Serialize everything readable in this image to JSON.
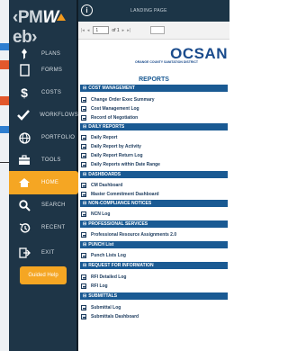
{
  "sidebar": {
    "logo": {
      "left": "‹PM",
      "right": "eb›"
    },
    "items": [
      {
        "label": "PLANS",
        "icon": "pin-icon"
      },
      {
        "label": "FORMS",
        "icon": "document-icon"
      },
      {
        "label": "COSTS",
        "icon": "dollar-icon"
      },
      {
        "label": "WORKFLOWS",
        "icon": "check-icon"
      },
      {
        "label": "PORTFOLIO",
        "icon": "globe-icon"
      },
      {
        "label": "TOOLS",
        "icon": "toolbox-icon"
      },
      {
        "label": "HOME",
        "icon": "home-icon"
      },
      {
        "label": "SEARCH",
        "icon": "search-icon"
      },
      {
        "label": "RECENT",
        "icon": "history-icon"
      },
      {
        "label": "EXIT",
        "icon": "exit-icon"
      }
    ],
    "guided_help": "Guided Help"
  },
  "topbar": {
    "title": "LANDING PAGE"
  },
  "pager": {
    "page": "1",
    "of": "of 1"
  },
  "report": {
    "brand": {
      "name": "OCSAN",
      "sub": "ORANGE COUNTY SANITATION DISTRICT"
    },
    "title": "REPORTS",
    "sections": [
      {
        "title": "COST MANAGEMENT",
        "rows": [
          "Change Order Exec Summary",
          "Cost Management Log",
          "Record of Negotiation"
        ]
      },
      {
        "title": "DAILY REPORTS",
        "rows": [
          "Daily Report",
          "Daily Report by Activity",
          "Daily Report Return Log",
          "Daily Reports within Date Range"
        ]
      },
      {
        "title": "DASHBOARDS",
        "rows": [
          "CM Dashboard",
          "Master Commitment Dashboard"
        ]
      },
      {
        "title": "NON-COMPLIANCE NOTICES",
        "rows": [
          "NCN Log"
        ]
      },
      {
        "title": "PROFESSIONAL SERVICES",
        "rows": [
          "Professional Resource Assignments 2.0"
        ]
      },
      {
        "title": "PUNCH List",
        "rows": [
          "Punch Lists Log"
        ]
      },
      {
        "title": "REQUEST FOR INFORMATION",
        "rows": [
          "RFI Detailed Log",
          "RFI Log"
        ]
      },
      {
        "title": "SUBMITTALS",
        "rows": [
          "Submittal Log",
          "Submittals Dashboard"
        ]
      }
    ]
  },
  "colors": {
    "sidebar": "#1e3547",
    "accent": "#f5a623",
    "section": "#1a5a93"
  }
}
